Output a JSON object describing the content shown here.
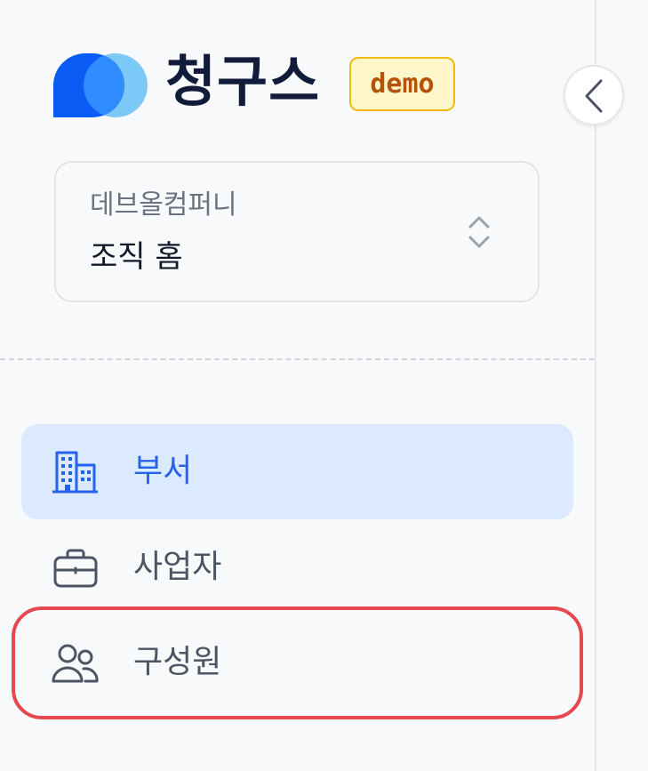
{
  "brand": {
    "name": "청구스",
    "badge": "demo",
    "logo_icon": "brand-logo-icon"
  },
  "collapse": {
    "icon": "chevron-left-icon"
  },
  "org_selector": {
    "organization": "데브올컴퍼니",
    "current_page": "조직 홈",
    "icon": "chevron-up-down-icon"
  },
  "nav": {
    "items": [
      {
        "label": "부서",
        "icon": "building-icon",
        "active": true
      },
      {
        "label": "사업자",
        "icon": "briefcase-icon",
        "active": false
      },
      {
        "label": "구성원",
        "icon": "users-icon",
        "active": false
      }
    ]
  },
  "colors": {
    "brand_dark": "#111b3a",
    "accent": "#2563eb",
    "active_bg": "#dbeafe",
    "badge_bg": "#fff7cc",
    "badge_border": "#f2b90f",
    "badge_text": "#b45309",
    "highlight": "#e5484d"
  }
}
